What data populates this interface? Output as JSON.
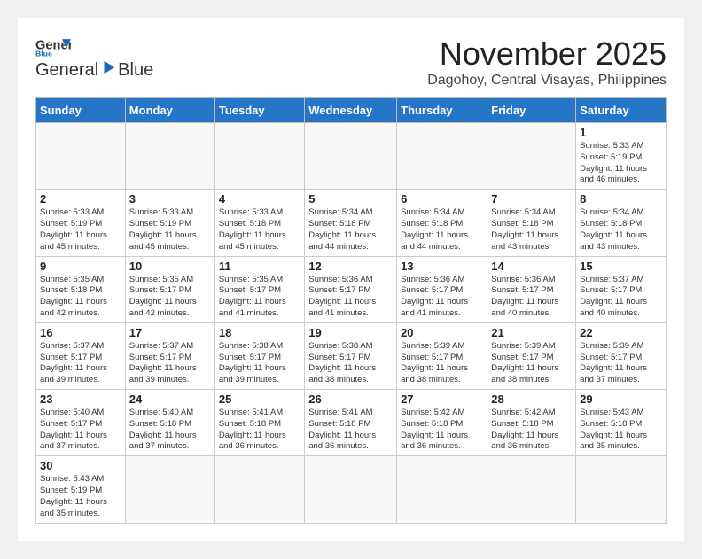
{
  "logo": {
    "line1": "General",
    "line2": "Blue"
  },
  "title": "November 2025",
  "location": "Dagohoy, Central Visayas, Philippines",
  "weekdays": [
    "Sunday",
    "Monday",
    "Tuesday",
    "Wednesday",
    "Thursday",
    "Friday",
    "Saturday"
  ],
  "weeks": [
    [
      {
        "day": "",
        "info": ""
      },
      {
        "day": "",
        "info": ""
      },
      {
        "day": "",
        "info": ""
      },
      {
        "day": "",
        "info": ""
      },
      {
        "day": "",
        "info": ""
      },
      {
        "day": "",
        "info": ""
      },
      {
        "day": "1",
        "info": "Sunrise: 5:33 AM\nSunset: 5:19 PM\nDaylight: 11 hours\nand 46 minutes."
      }
    ],
    [
      {
        "day": "2",
        "info": "Sunrise: 5:33 AM\nSunset: 5:19 PM\nDaylight: 11 hours\nand 45 minutes."
      },
      {
        "day": "3",
        "info": "Sunrise: 5:33 AM\nSunset: 5:19 PM\nDaylight: 11 hours\nand 45 minutes."
      },
      {
        "day": "4",
        "info": "Sunrise: 5:33 AM\nSunset: 5:18 PM\nDaylight: 11 hours\nand 45 minutes."
      },
      {
        "day": "5",
        "info": "Sunrise: 5:34 AM\nSunset: 5:18 PM\nDaylight: 11 hours\nand 44 minutes."
      },
      {
        "day": "6",
        "info": "Sunrise: 5:34 AM\nSunset: 5:18 PM\nDaylight: 11 hours\nand 44 minutes."
      },
      {
        "day": "7",
        "info": "Sunrise: 5:34 AM\nSunset: 5:18 PM\nDaylight: 11 hours\nand 43 minutes."
      },
      {
        "day": "8",
        "info": "Sunrise: 5:34 AM\nSunset: 5:18 PM\nDaylight: 11 hours\nand 43 minutes."
      }
    ],
    [
      {
        "day": "9",
        "info": "Sunrise: 5:35 AM\nSunset: 5:18 PM\nDaylight: 11 hours\nand 42 minutes."
      },
      {
        "day": "10",
        "info": "Sunrise: 5:35 AM\nSunset: 5:17 PM\nDaylight: 11 hours\nand 42 minutes."
      },
      {
        "day": "11",
        "info": "Sunrise: 5:35 AM\nSunset: 5:17 PM\nDaylight: 11 hours\nand 41 minutes."
      },
      {
        "day": "12",
        "info": "Sunrise: 5:36 AM\nSunset: 5:17 PM\nDaylight: 11 hours\nand 41 minutes."
      },
      {
        "day": "13",
        "info": "Sunrise: 5:36 AM\nSunset: 5:17 PM\nDaylight: 11 hours\nand 41 minutes."
      },
      {
        "day": "14",
        "info": "Sunrise: 5:36 AM\nSunset: 5:17 PM\nDaylight: 11 hours\nand 40 minutes."
      },
      {
        "day": "15",
        "info": "Sunrise: 5:37 AM\nSunset: 5:17 PM\nDaylight: 11 hours\nand 40 minutes."
      }
    ],
    [
      {
        "day": "16",
        "info": "Sunrise: 5:37 AM\nSunset: 5:17 PM\nDaylight: 11 hours\nand 39 minutes."
      },
      {
        "day": "17",
        "info": "Sunrise: 5:37 AM\nSunset: 5:17 PM\nDaylight: 11 hours\nand 39 minutes."
      },
      {
        "day": "18",
        "info": "Sunrise: 5:38 AM\nSunset: 5:17 PM\nDaylight: 11 hours\nand 39 minutes."
      },
      {
        "day": "19",
        "info": "Sunrise: 5:38 AM\nSunset: 5:17 PM\nDaylight: 11 hours\nand 38 minutes."
      },
      {
        "day": "20",
        "info": "Sunrise: 5:39 AM\nSunset: 5:17 PM\nDaylight: 11 hours\nand 38 minutes."
      },
      {
        "day": "21",
        "info": "Sunrise: 5:39 AM\nSunset: 5:17 PM\nDaylight: 11 hours\nand 38 minutes."
      },
      {
        "day": "22",
        "info": "Sunrise: 5:39 AM\nSunset: 5:17 PM\nDaylight: 11 hours\nand 37 minutes."
      }
    ],
    [
      {
        "day": "23",
        "info": "Sunrise: 5:40 AM\nSunset: 5:17 PM\nDaylight: 11 hours\nand 37 minutes."
      },
      {
        "day": "24",
        "info": "Sunrise: 5:40 AM\nSunset: 5:18 PM\nDaylight: 11 hours\nand 37 minutes."
      },
      {
        "day": "25",
        "info": "Sunrise: 5:41 AM\nSunset: 5:18 PM\nDaylight: 11 hours\nand 36 minutes."
      },
      {
        "day": "26",
        "info": "Sunrise: 5:41 AM\nSunset: 5:18 PM\nDaylight: 11 hours\nand 36 minutes."
      },
      {
        "day": "27",
        "info": "Sunrise: 5:42 AM\nSunset: 5:18 PM\nDaylight: 11 hours\nand 36 minutes."
      },
      {
        "day": "28",
        "info": "Sunrise: 5:42 AM\nSunset: 5:18 PM\nDaylight: 11 hours\nand 36 minutes."
      },
      {
        "day": "29",
        "info": "Sunrise: 5:43 AM\nSunset: 5:18 PM\nDaylight: 11 hours\nand 35 minutes."
      }
    ],
    [
      {
        "day": "30",
        "info": "Sunrise: 5:43 AM\nSunset: 5:19 PM\nDaylight: 11 hours\nand 35 minutes."
      },
      {
        "day": "",
        "info": ""
      },
      {
        "day": "",
        "info": ""
      },
      {
        "day": "",
        "info": ""
      },
      {
        "day": "",
        "info": ""
      },
      {
        "day": "",
        "info": ""
      },
      {
        "day": "",
        "info": ""
      }
    ]
  ]
}
